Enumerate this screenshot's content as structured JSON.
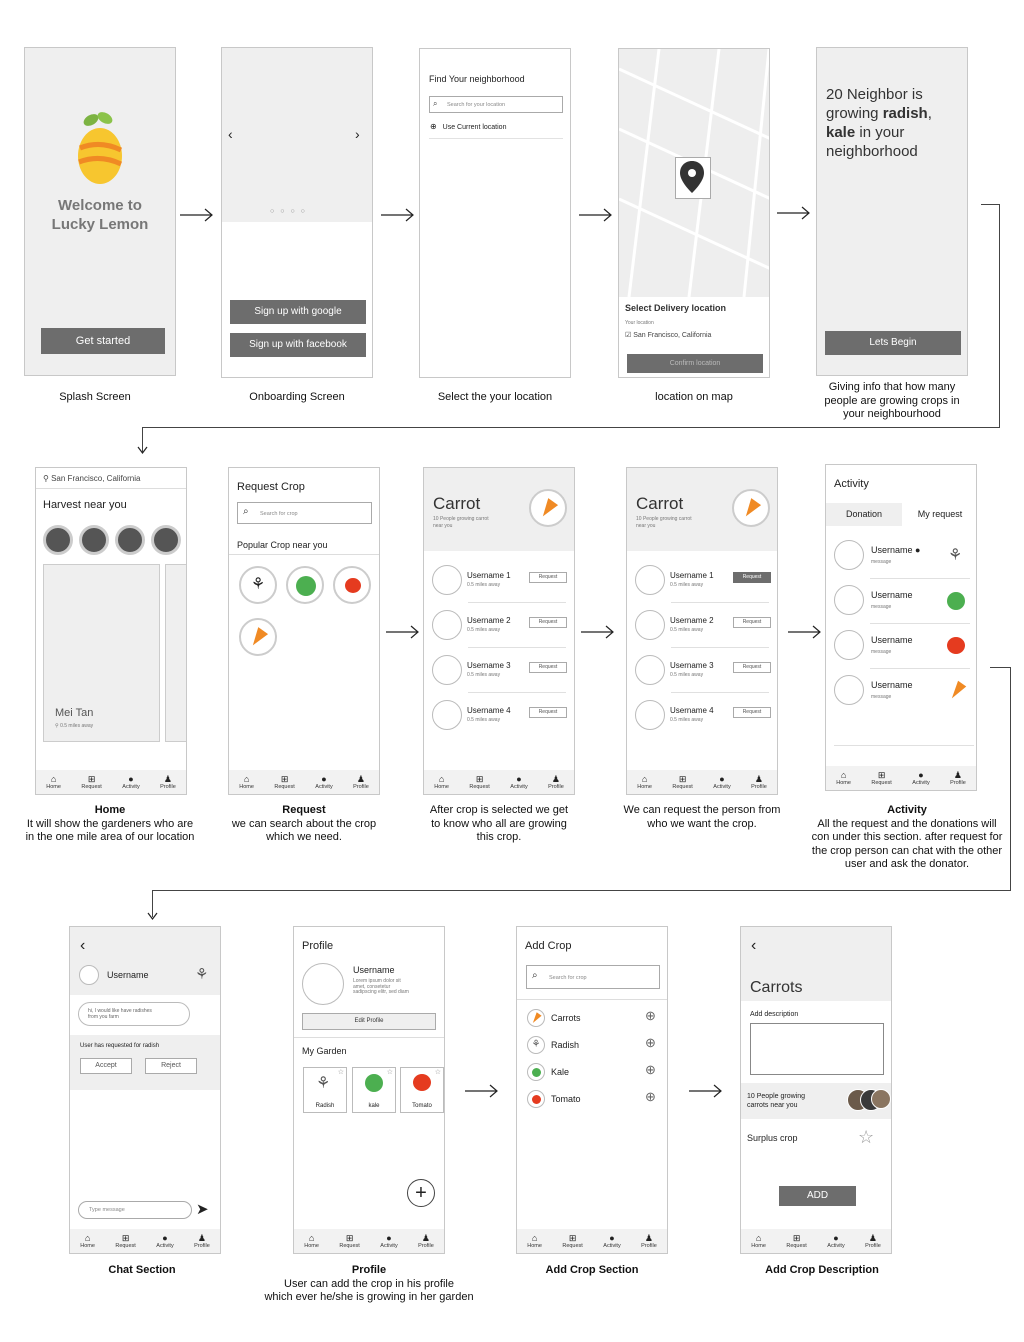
{
  "colors": {
    "button": "#6d6d6d",
    "accent_orange": "#f08a24",
    "lemon": "#f7c62f",
    "leaf_green": "#4caf50",
    "tomato": "#e53b1f"
  },
  "nav": {
    "home": "Home",
    "request": "Request",
    "activity": "Activity",
    "profile": "Profile"
  },
  "s1": {
    "title_l1": "Welcome to",
    "title_l2": "Lucky Lemon",
    "button": "Get started",
    "caption": "Splash Screen"
  },
  "s2": {
    "btn_google": "Sign up with google",
    "btn_facebook": "Sign up with facebook",
    "caption": "Onboarding Screen"
  },
  "s3": {
    "title": "Find Your neighborhood",
    "search_placeholder": "Search for your location",
    "use_current": "Use Current location",
    "caption": "Select the your location"
  },
  "s4": {
    "panel_title": "Select Delivery location",
    "your_location": "Your location",
    "location": "San Francisco, California",
    "confirm": "Confirm location",
    "caption": "location on map"
  },
  "s5": {
    "line1": "20 Neighbor is",
    "line2a": "growing ",
    "line2b": "radish",
    ",": ",",
    "line3a": "kale",
    "line3b": " in your",
    "line4": "neighborhood",
    "button": "Lets Begin",
    "cap1": "Giving info that how many",
    "cap2": "people are growing crops in",
    "cap3": "your neighbourhood"
  },
  "s6": {
    "location": "San Francisco, California",
    "heading": "Harvest near you",
    "card_name": "Mei Tan",
    "card_dist": "0.5 miles away",
    "cap_title": "Home",
    "cap1": "It will show the gardeners who are",
    "cap2": "in the one mile area of our location"
  },
  "s7": {
    "title": "Request Crop",
    "search": "Search for crop",
    "section": "Popular Crop near you",
    "cap_title": "Request",
    "cap1": "we can search about the crop",
    "cap2": "which we need."
  },
  "s8": {
    "title": "Carrot",
    "sub1": "10 People growing carrot",
    "sub2": "near you",
    "users": [
      {
        "name": "Username 1",
        "dist": "0.5 miles away",
        "btn": "Request"
      },
      {
        "name": "Username 2",
        "dist": "0.5 miles away",
        "btn": "Request"
      },
      {
        "name": "Username 3",
        "dist": "0.5 miles away",
        "btn": "Request"
      },
      {
        "name": "Username 4",
        "dist": "0.5 miles away",
        "btn": "Request"
      }
    ],
    "cap1": "After crop is selected we get",
    "cap2": "to know who all are growing",
    "cap3": "this crop."
  },
  "s9": {
    "title": "Carrot",
    "sub1": "10 People growing carrot",
    "sub2": "near you",
    "users": [
      {
        "name": "Username 1",
        "dist": "0.5 miles away",
        "btn": "Request"
      },
      {
        "name": "Username 2",
        "dist": "0.5 miles away",
        "btn": "Request"
      },
      {
        "name": "Username 3",
        "dist": "0.5 miles away",
        "btn": "Request"
      },
      {
        "name": "Username 4",
        "dist": "0.5 miles away",
        "btn": "Request"
      }
    ],
    "cap1": "We can request the person from",
    "cap2": "who we want the crop."
  },
  "s10": {
    "title": "Activity",
    "tab1": "Donation",
    "tab2": "My request",
    "items": [
      {
        "name": "Username",
        "msg": "message"
      },
      {
        "name": "Username",
        "msg": "message"
      },
      {
        "name": "Username",
        "msg": "message"
      },
      {
        "name": "Username",
        "msg": "message"
      }
    ],
    "cap_title": "Activity",
    "cap1": "All the request and the donations will",
    "cap2": "con under this section. after request for",
    "cap3": "the crop person can chat with the other",
    "cap4": "user and ask the donator."
  },
  "s11": {
    "username": "Username",
    "bubble1": "hi, I would like have radishes",
    "bubble2": "from you farm",
    "req_text": "User has requested for radish",
    "accept": "Accept",
    "reject": "Reject",
    "type_msg": "Type message",
    "caption": "Chat Section"
  },
  "s12": {
    "title": "Profile",
    "username": "Username",
    "bio1": "Lorem ipsum dolor sit",
    "bio2": "amet, consetetur",
    "bio3": "sadipscing elitr, sed diam",
    "edit": "Edit Profile",
    "garden": "My Garden",
    "crops": [
      "Radish",
      "kale",
      "Tomato"
    ],
    "cap_title": "Profile",
    "cap1": "User can add the crop in his profile",
    "cap2": "which ever he/she is growing in her garden"
  },
  "s13": {
    "title": "Add Crop",
    "search": "Search for crop",
    "crops": [
      "Carrots",
      "Radish",
      "Kale",
      "Tomato"
    ],
    "caption": "Add Crop Section"
  },
  "s14": {
    "title": "Carrots",
    "desc_label": "Add description",
    "growing1": "10 People growing",
    "growing2": "carrots near you",
    "surplus": "Surplus crop",
    "add": "ADD",
    "caption": "Add Crop Description"
  }
}
